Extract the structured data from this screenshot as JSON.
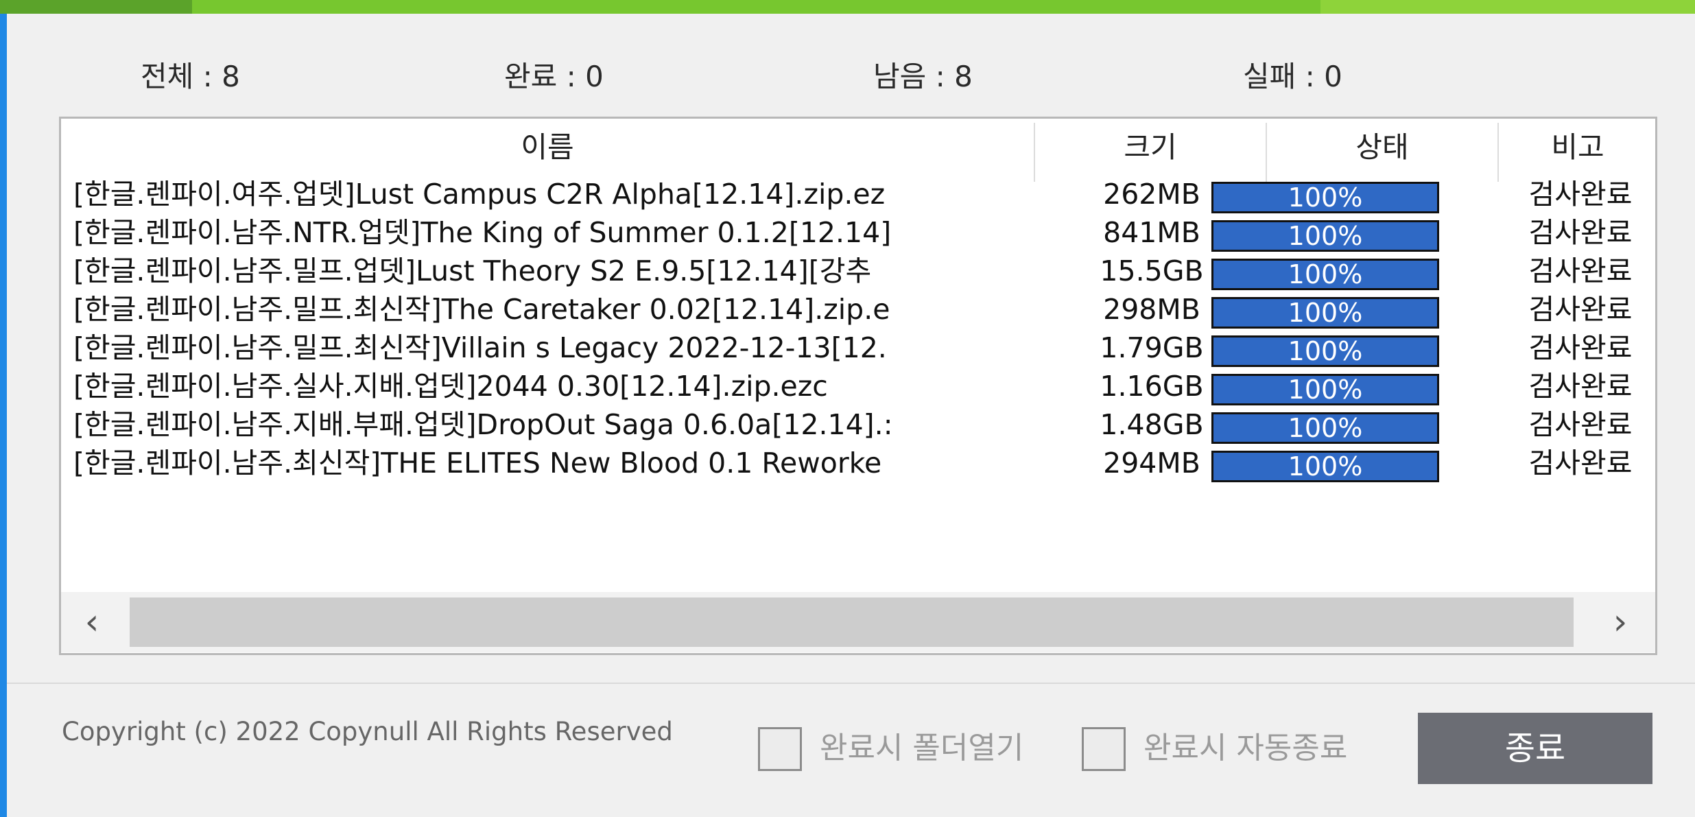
{
  "summary": {
    "total": "전체 : 8",
    "done": "완료 : 0",
    "remaining": "남음 : 8",
    "failed": "실패 : 0"
  },
  "columns": {
    "name": "이름",
    "size": "크기",
    "status": "상태",
    "note": "비고"
  },
  "rows": [
    {
      "name": "[한글.렌파이.여주.업뎃]Lust Campus C2R Alpha[12.14].zip.ez",
      "size": "262MB",
      "status": "100%",
      "progress": 1.0,
      "note": "검사완료"
    },
    {
      "name": "[한글.렌파이.남주.NTR.업뎃]The King of Summer 0.1.2[12.14]",
      "size": "841MB",
      "status": "100%",
      "progress": 1.0,
      "note": "검사완료"
    },
    {
      "name": "[한글.렌파이.남주.밀프.업뎃]Lust Theory S2 E.9.5[12.14][강추",
      "size": "15.5GB",
      "status": "100%",
      "progress": 1.0,
      "note": "검사완료"
    },
    {
      "name": "[한글.렌파이.남주.밀프.최신작]The Caretaker 0.02[12.14].zip.e",
      "size": "298MB",
      "status": "100%",
      "progress": 1.0,
      "note": "검사완료"
    },
    {
      "name": "[한글.렌파이.남주.밀프.최신작]Villain s Legacy 2022-12-13[12.",
      "size": "1.79GB",
      "status": "100%",
      "progress": 1.0,
      "note": "검사완료"
    },
    {
      "name": "[한글.렌파이.남주.실사.지배.업뎃]2044 0.30[12.14].zip.ezc",
      "size": "1.16GB",
      "status": "100%",
      "progress": 1.0,
      "note": "검사완료"
    },
    {
      "name": "[한글.렌파이.남주.지배.부패.업뎃]DropOut Saga 0.6.0a[12.14].:",
      "size": "1.48GB",
      "status": "100%",
      "progress": 1.0,
      "note": "검사완료"
    },
    {
      "name": "[한글.렌파이.남주.최신작]THE ELITES New Blood 0.1 Reworke",
      "size": "294MB",
      "status": "100%",
      "progress": 1.0,
      "note": "검사완료"
    }
  ],
  "scroll": {
    "left_glyph": "‹",
    "right_glyph": "›"
  },
  "footer": {
    "copyright": "Copyright (c) 2022 Copynull All Rights Reserved",
    "open_folder_label": "완료시 폴더열기",
    "auto_exit_label": "완료시 자동종료",
    "exit_button": "종료"
  },
  "colors": {
    "progress_green": "#77c72f",
    "bar_blue": "#2f69c5",
    "button_gray": "#6b6d74",
    "window_edge_blue": "#1e88e5"
  }
}
